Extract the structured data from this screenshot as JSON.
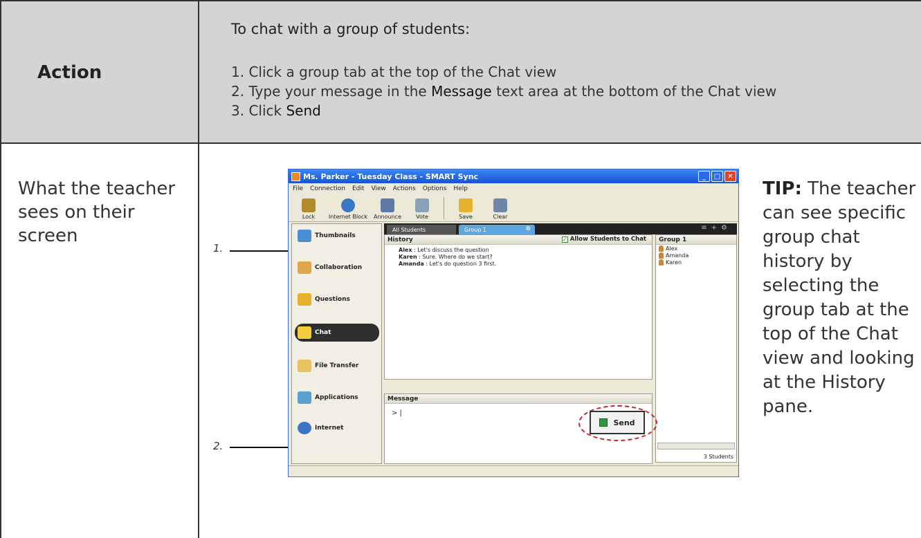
{
  "action": {
    "heading": "Action",
    "intro": "To chat with a group of students:",
    "steps": [
      {
        "pre": "1. Click a group tab at the top of the Chat view",
        "kw": "",
        "post": ""
      },
      {
        "pre": "2. Type your message in the ",
        "kw": "Message",
        "post": " text area at the bottom of the Chat view"
      },
      {
        "pre": "3. Click ",
        "kw": "Send",
        "post": ""
      }
    ]
  },
  "sees": {
    "label": "What the teacher sees on their screen"
  },
  "tip": {
    "lead": "TIP:",
    "text": " The teacher can see specific group chat history by selecting the group tab at the top of the Chat view and looking at the History pane."
  },
  "callouts": [
    "1.",
    "2."
  ],
  "app": {
    "title": "Ms.   Parker - Tuesday Class - SMART Sync",
    "menu": [
      "File",
      "Connection",
      "Edit",
      "View",
      "Actions",
      "Options",
      "Help"
    ],
    "toolbar": [
      {
        "label": "Lock",
        "icon": "lock-icon",
        "color": "#b28a2c"
      },
      {
        "label": "Internet Block",
        "icon": "internet-block-icon",
        "color": "#3b76c9"
      },
      {
        "label": "Announce",
        "icon": "announce-icon",
        "color": "#5d7aa6"
      },
      {
        "label": "Vote",
        "icon": "vote-icon",
        "color": "#8aa1b8"
      },
      {
        "label": "Save",
        "icon": "save-icon",
        "color": "#e6b12e"
      },
      {
        "label": "Clear",
        "icon": "clear-icon",
        "color": "#6f86a8"
      }
    ],
    "sidebar": [
      {
        "label": "Thumbnails",
        "icon": "thumbnails-icon",
        "color": "#4a8fd6"
      },
      {
        "label": "Collaboration",
        "icon": "collaboration-icon",
        "color": "#e0a64a"
      },
      {
        "label": "Questions",
        "icon": "questions-icon",
        "color": "#e5b22a"
      },
      {
        "label": "Chat",
        "icon": "chat-icon",
        "color": "#f2cf3a"
      },
      {
        "label": "File Transfer",
        "icon": "file-transfer-icon",
        "color": "#e8c25e"
      },
      {
        "label": "Applications",
        "icon": "applications-icon",
        "color": "#5aa0d0"
      },
      {
        "label": "Internet",
        "icon": "internet-icon",
        "color": "#3b76c9"
      }
    ],
    "tabs": [
      "All Students",
      "Group 1"
    ],
    "history_label": "History",
    "allow_label": "Allow Students to Chat",
    "messages": [
      {
        "name": "Alex",
        "text": " :  Let's discuss the question"
      },
      {
        "name": "Karen",
        "text": " :  Sure. Where do we start?"
      },
      {
        "name": "Amanda",
        "text": " :  Let's do question 3 first."
      }
    ],
    "group_label": "Group 1",
    "members": [
      "Alex",
      "Amanda",
      "Karen"
    ],
    "message_label": "Message",
    "message_value": "> |",
    "send_label": "Send",
    "students_count": "3 Students"
  }
}
